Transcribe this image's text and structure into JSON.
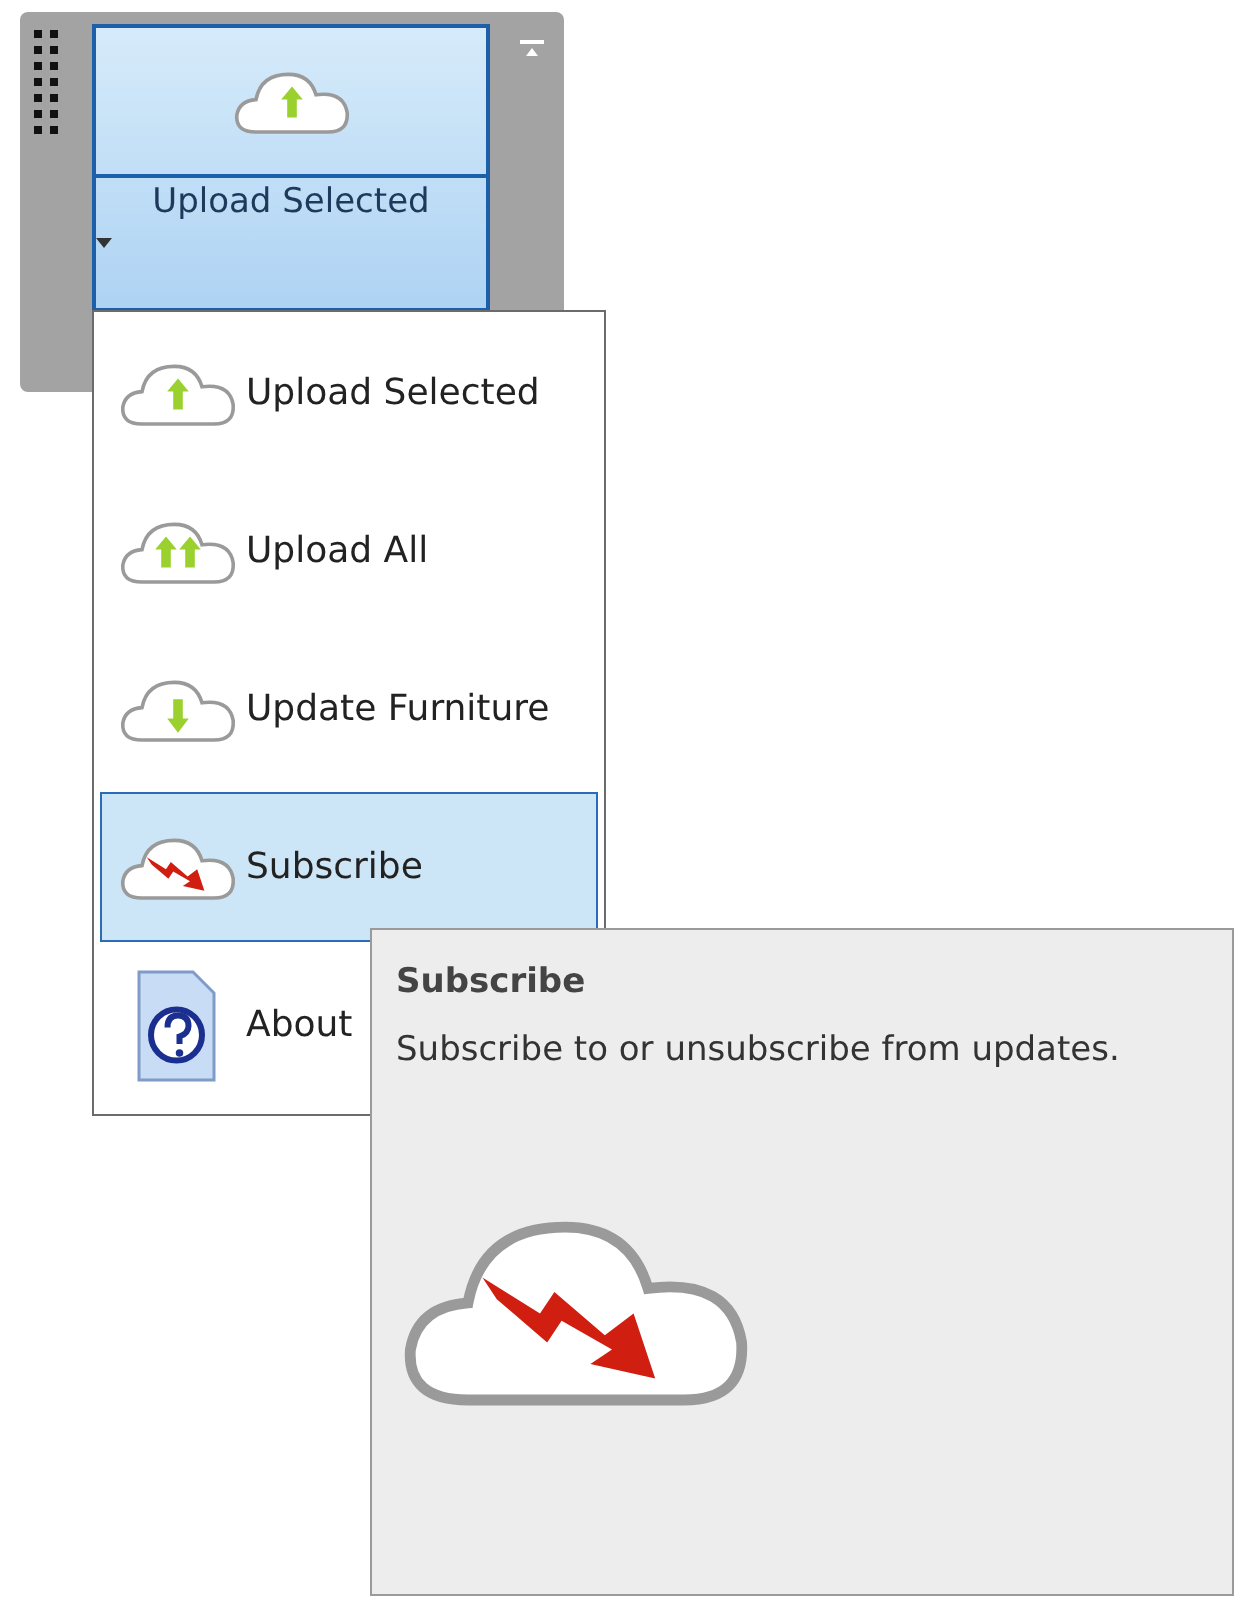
{
  "ribbon_button": {
    "label": "Upload Selected",
    "expanded": true
  },
  "menu": {
    "items": [
      {
        "kind": "upload",
        "label": "Upload Selected",
        "selected": false
      },
      {
        "kind": "uploadall",
        "label": "Upload All",
        "selected": false
      },
      {
        "kind": "download",
        "label": "Update Furniture",
        "selected": false
      },
      {
        "kind": "subscribe",
        "label": "Subscribe",
        "selected": true
      },
      {
        "kind": "about",
        "label": "About",
        "selected": false
      }
    ]
  },
  "tooltip": {
    "kind": "subscribe",
    "title": "Subscribe",
    "description": "Subscribe to or unsubscribe from updates."
  }
}
